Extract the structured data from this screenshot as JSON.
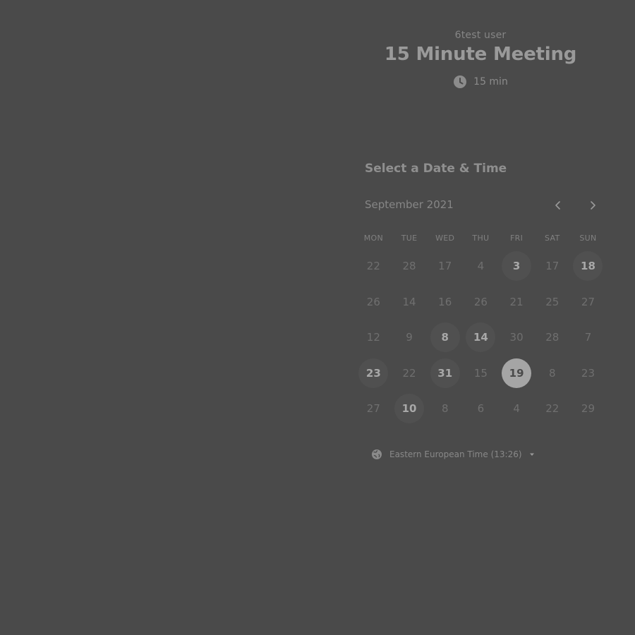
{
  "event": {
    "owner": "6test user",
    "title": "15 Minute Meeting",
    "duration": "15 min"
  },
  "calendar": {
    "section_title": "Select a Date & Time",
    "month": "September 2021",
    "weekdays": [
      "MON",
      "TUE",
      "WED",
      "THU",
      "FRI",
      "SAT",
      "SUN"
    ],
    "days": [
      [
        "22",
        "28",
        "17",
        "4",
        "3",
        "17",
        "18"
      ],
      [
        "26",
        "14",
        "16",
        "26",
        "21",
        "25",
        "27"
      ],
      [
        "12",
        "9",
        "8",
        "14",
        "30",
        "28",
        "7"
      ],
      [
        "23",
        "22",
        "31",
        "15",
        "19",
        "8",
        "23"
      ],
      [
        "27",
        "10",
        "8",
        "6",
        "4",
        "22",
        "29"
      ]
    ],
    "available": [
      [
        0,
        4
      ],
      [
        0,
        6
      ],
      [
        2,
        2
      ],
      [
        2,
        3
      ],
      [
        3,
        0
      ],
      [
        3,
        2
      ],
      [
        4,
        1
      ]
    ],
    "selected": [
      3,
      4
    ]
  },
  "timezone": {
    "label": "Eastern European Time (13:26)"
  },
  "icons": {
    "duration": "clock-icon",
    "prev": "chevron-left-icon",
    "next": "chevron-right-icon",
    "timezone": "globe-icon",
    "dropdown": "caret-down-icon"
  },
  "colors": {
    "background": "#4a4a4a",
    "selected_day": "#a5a5a5",
    "available_day": "#505050"
  }
}
